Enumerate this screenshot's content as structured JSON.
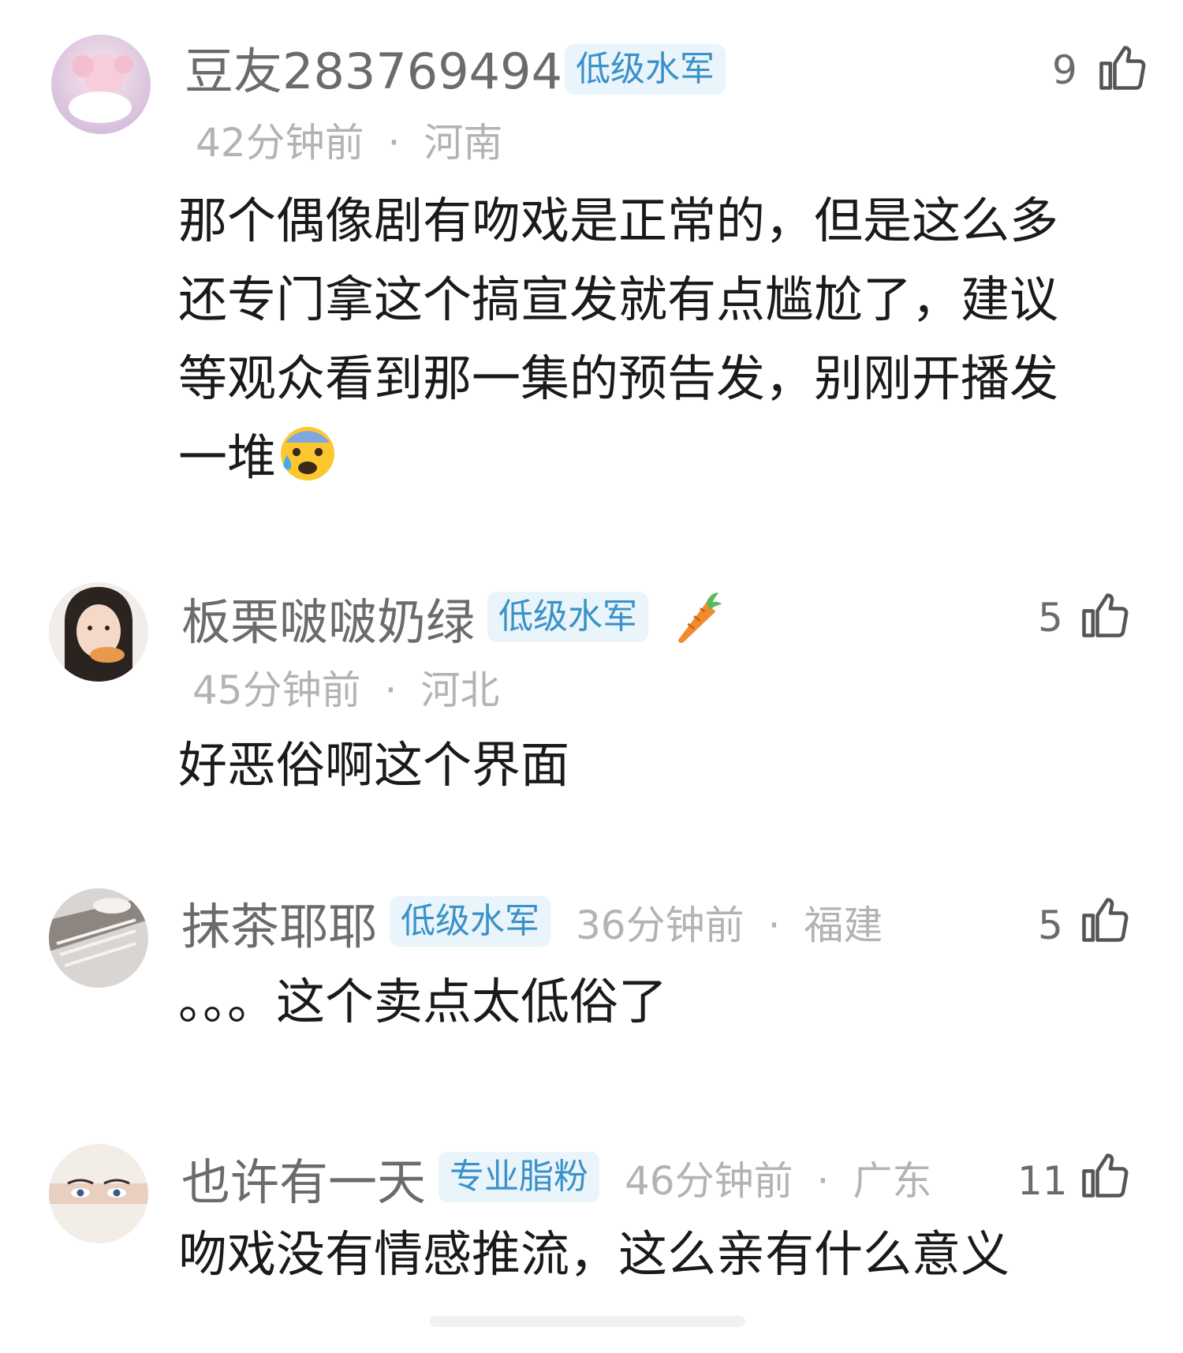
{
  "comments": [
    {
      "username": "豆友283769494",
      "badge": "低级水军",
      "time": "42分钟前",
      "separator": "·",
      "location": "河南",
      "likes": "9",
      "text_lines": [
        "那个偶像剧有吻戏是正常的，但是这么多",
        "还专门拿这个搞宣发就有点尴尬了，建议",
        "等观众看到那一集的预告发，别刚开播发",
        "一堆"
      ],
      "emoji": "anxious-sweat-face-icon"
    },
    {
      "username": "板栗啵啵奶绿",
      "badge": "低级水军",
      "decoration": "carrot-icon",
      "time": "45分钟前",
      "separator": "·",
      "location": "河北",
      "likes": "5",
      "text": "好恶俗啊这个界面"
    },
    {
      "username": "抹茶耶耶",
      "badge": "低级水军",
      "time": "36分钟前",
      "separator": "·",
      "location": "福建",
      "likes": "5",
      "text": "。。。这个卖点太低俗了"
    },
    {
      "username": "也许有一天",
      "badge": "专业脂粉",
      "time": "46分钟前",
      "separator": "·",
      "location": "广东",
      "likes": "11",
      "text": "吻戏没有情感推流，这么亲有什么意义"
    }
  ],
  "icons": {
    "like": "thumbs-up-icon"
  },
  "colors": {
    "badge_bg": "#eaf4fb",
    "badge_text": "#3a92c8",
    "username": "#6b6b6b",
    "meta": "#b3b3b3",
    "body": "#1a1a1a"
  }
}
